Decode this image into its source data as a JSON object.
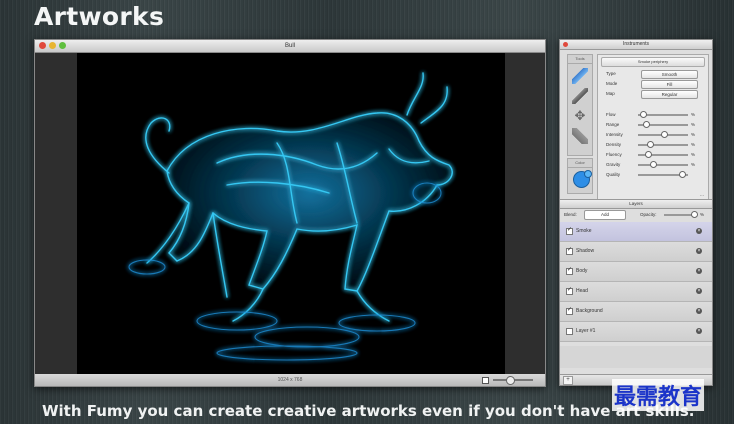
{
  "headline": "Artworks",
  "caption": "With Fumy you can create creative artworks even if you don't have art skills.",
  "watermark": "最需教育",
  "main_window": {
    "title": "Bull",
    "status": "1024 x 768"
  },
  "instruments": {
    "title": "Instruments",
    "tools_header": "Tools",
    "color_header": "Color",
    "color_primary": "#2e8ee6",
    "preset_button": "Smoke periphery",
    "tool_icons": [
      "brush-icon",
      "pen-icon",
      "move-icon",
      "bucket-icon"
    ],
    "selects": [
      {
        "label": "Type",
        "value": "Smooth"
      },
      {
        "label": "Mode",
        "value": "Fill"
      },
      {
        "label": "Map",
        "value": "Regular"
      }
    ],
    "sliders": [
      {
        "label": "Flow",
        "value": 0.05,
        "unit": "%"
      },
      {
        "label": "Range",
        "value": 0.1,
        "unit": "%"
      },
      {
        "label": "Intensity",
        "value": 0.5,
        "unit": "%"
      },
      {
        "label": "Density",
        "value": 0.2,
        "unit": "%"
      },
      {
        "label": "Fluency",
        "value": 0.15,
        "unit": "%"
      },
      {
        "label": "Gravity",
        "value": 0.25,
        "unit": "%"
      },
      {
        "label": "Quality",
        "value": 0.9,
        "unit": ""
      }
    ],
    "more": "..."
  },
  "layers": {
    "title": "Layers",
    "blend_label": "Blend:",
    "blend_value": "Add",
    "opacity_label": "Opacity:",
    "opacity_unit": "%",
    "items": [
      {
        "name": "Smoke",
        "checked": true,
        "selected": true
      },
      {
        "name": "Shadow",
        "checked": true,
        "selected": false
      },
      {
        "name": "Body",
        "checked": true,
        "selected": false
      },
      {
        "name": "Head",
        "checked": true,
        "selected": false
      },
      {
        "name": "Background",
        "checked": true,
        "selected": false
      },
      {
        "name": "Layer #1",
        "checked": false,
        "selected": false
      }
    ],
    "add_label": "+"
  }
}
